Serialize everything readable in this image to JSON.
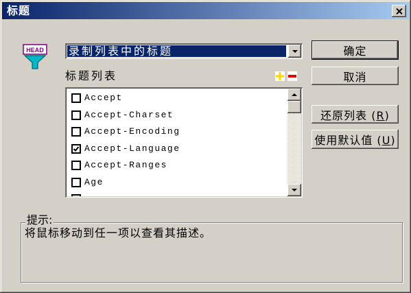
{
  "window": {
    "title": "标题",
    "close_icon": "close-icon"
  },
  "colors": {
    "title_start": "#0A246A",
    "title_end": "#A6CAF0",
    "selection": "#0A246A",
    "add_icon": "#FFD800",
    "remove_icon": "#E00000"
  },
  "header": {
    "icon": "header-filter-icon",
    "icon_text": "HEAD",
    "source_value": "录制列表中的标题",
    "dropdown_icon": "chevron-down-icon"
  },
  "list": {
    "label": "标题列表",
    "add_icon": "plus-icon",
    "remove_icon": "minus-icon",
    "items": [
      {
        "label": "Accept",
        "checked": false
      },
      {
        "label": "Accept-Charset",
        "checked": false
      },
      {
        "label": "Accept-Encoding",
        "checked": false
      },
      {
        "label": "Accept-Language",
        "checked": true
      },
      {
        "label": "Accept-Ranges",
        "checked": false
      },
      {
        "label": "Age",
        "checked": false
      },
      {
        "label": "",
        "checked": false
      }
    ],
    "scroll_position": 0
  },
  "buttons": {
    "ok": "确定",
    "cancel": "取消",
    "restore": {
      "pre": "还原列表 (",
      "key": "R",
      "post": ")"
    },
    "defaults": {
      "pre": "使用默认值 (",
      "key": "U",
      "post": ")"
    }
  },
  "hint": {
    "label": "提示:",
    "text": "将鼠标移动到任一项以查看其描述。"
  }
}
